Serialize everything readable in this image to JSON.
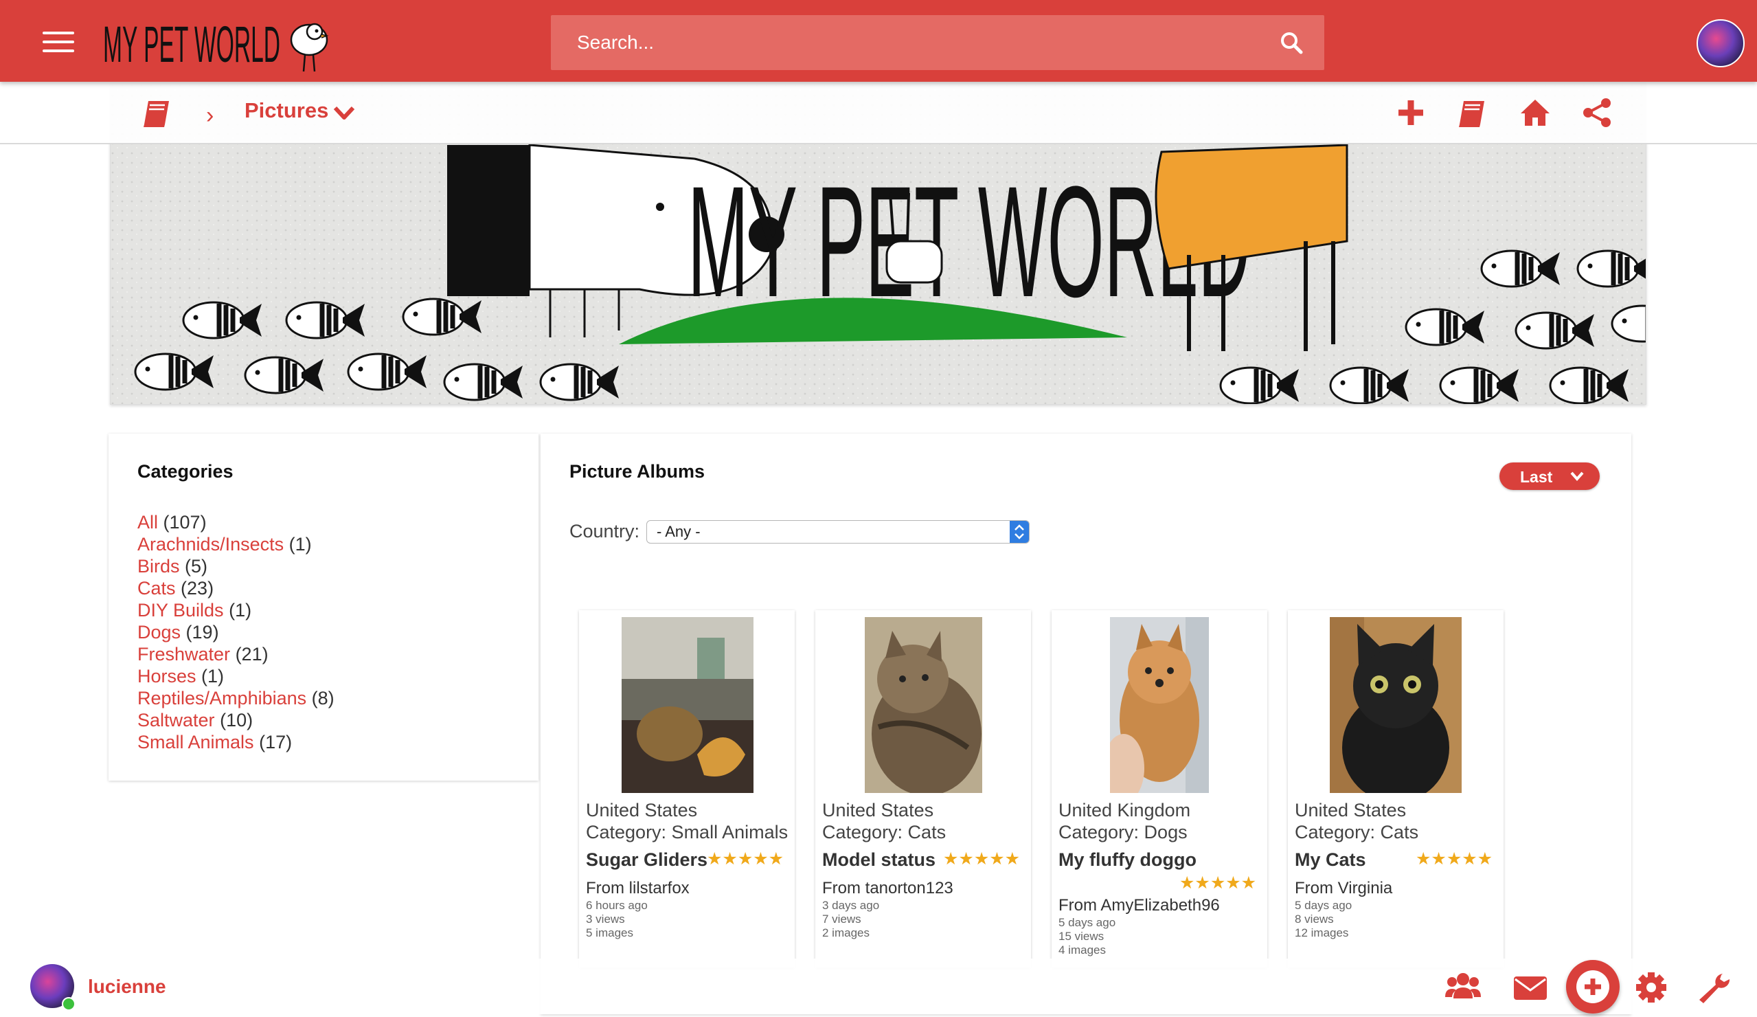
{
  "header": {
    "logo_text": "MY PET WORLD",
    "search_placeholder": "Search...",
    "brand_color": "#d9403b"
  },
  "breadcrumb": {
    "title": "Pictures",
    "separator": "›"
  },
  "banner": {
    "logo_text": "MY PET WORLD"
  },
  "categories": {
    "title": "Categories",
    "items": [
      {
        "label": "All",
        "count": "(107)"
      },
      {
        "label": "Arachnids/Insects",
        "count": "(1)"
      },
      {
        "label": "Birds",
        "count": "(5)"
      },
      {
        "label": "Cats",
        "count": "(23)"
      },
      {
        "label": "DIY Builds",
        "count": "(1)"
      },
      {
        "label": "Dogs",
        "count": "(19)"
      },
      {
        "label": "Freshwater",
        "count": "(21)"
      },
      {
        "label": "Horses",
        "count": "(1)"
      },
      {
        "label": "Reptiles/Amphibians",
        "count": "(8)"
      },
      {
        "label": "Saltwater",
        "count": "(10)"
      },
      {
        "label": "Small Animals",
        "count": "(17)"
      }
    ]
  },
  "albums": {
    "title": "Picture Albums",
    "sort_label": "Last",
    "country_label": "Country:",
    "country_value": "- Any -",
    "cards": [
      {
        "country": "United States",
        "category": "Category: Small Animals",
        "title": "Sugar Gliders",
        "rating": 5,
        "from": "From lilstarfox",
        "age": "6 hours ago",
        "views": "3 views",
        "images": "5 images"
      },
      {
        "country": "United States",
        "category": "Category: Cats",
        "title": "Model status",
        "rating": 5,
        "from": "From tanorton123",
        "age": "3 days ago",
        "views": "7 views",
        "images": "2 images"
      },
      {
        "country": "United Kingdom",
        "category": "Category: Dogs",
        "title": "My fluffy doggo",
        "rating": 5,
        "from": "From AmyElizabeth96",
        "age": "5 days ago",
        "views": "15 views",
        "images": "4 images"
      },
      {
        "country": "United States",
        "category": "Category: Cats",
        "title": "My Cats",
        "rating": 5,
        "from": "From Virginia",
        "age": "5 days ago",
        "views": "8 views",
        "images": "12 images"
      }
    ]
  },
  "footer": {
    "username": "lucienne",
    "status": "online"
  },
  "icons": [
    "menu-icon",
    "search-icon",
    "book-icon",
    "chevron-right-icon",
    "chevron-down-icon",
    "plus-icon",
    "home-icon",
    "share-icon",
    "users-icon",
    "envelope-icon",
    "gear-icon",
    "wrench-icon"
  ]
}
